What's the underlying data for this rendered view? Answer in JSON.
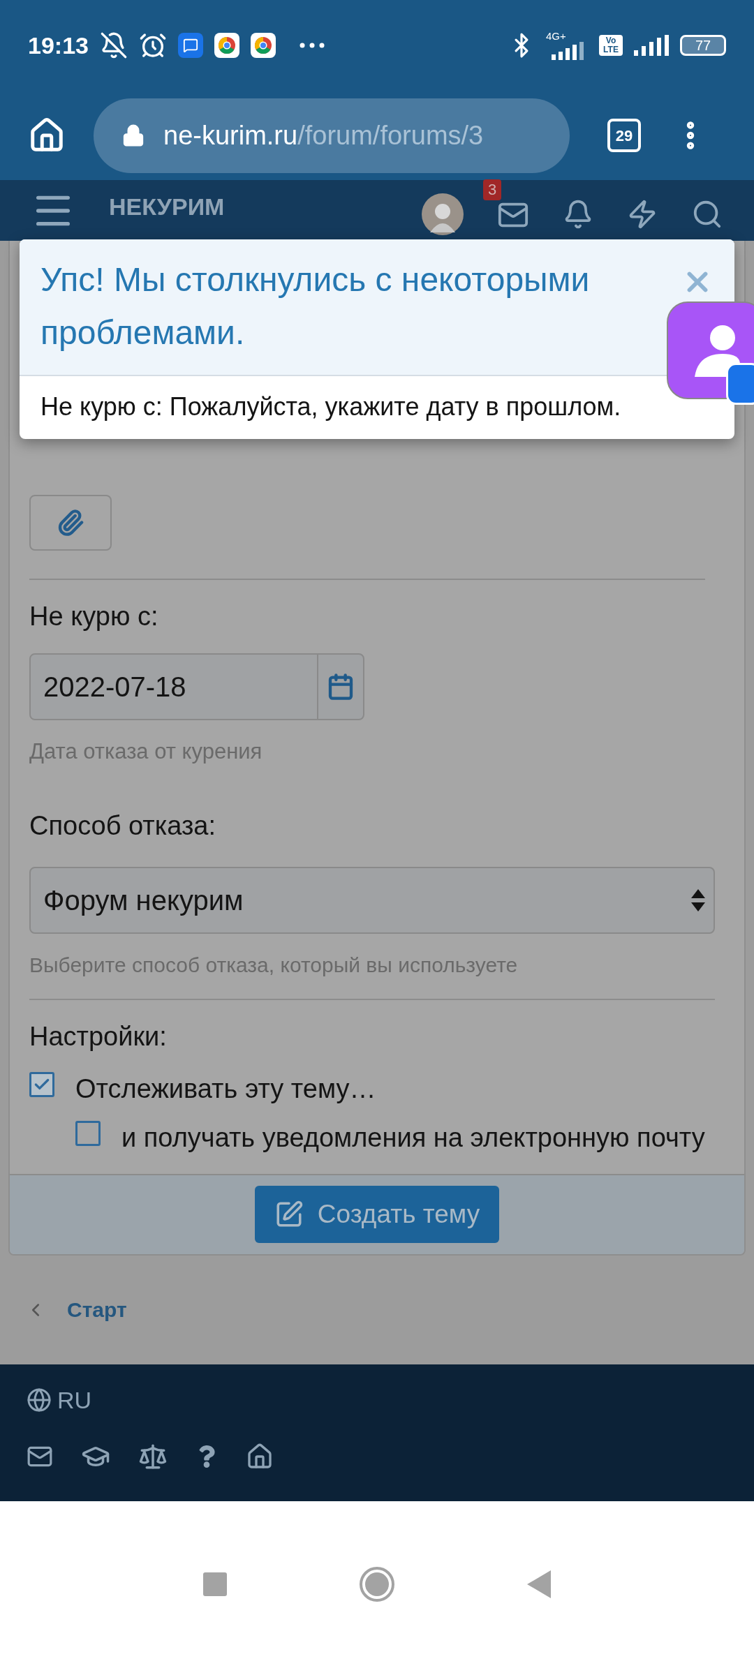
{
  "status_bar": {
    "time": "19:13",
    "network": "4G+",
    "volte": "Vo LTE",
    "battery": "77"
  },
  "browser": {
    "url_domain": "ne-kurim.ru",
    "url_path": "/forum/forums/3",
    "tab_count": "29"
  },
  "site_header": {
    "logo": "НЕКУРИМ",
    "message_badge": "3"
  },
  "error_dialog": {
    "title": "Упс! Мы столкнулись с некоторыми проблемами.",
    "message": "Не курю с: Пожалуйста, укажите дату в прошлом."
  },
  "form": {
    "date_field": {
      "label": "Не курю с:",
      "value": "2022-07-18",
      "hint": "Дата отказа от курения"
    },
    "method_field": {
      "label": "Способ отказа:",
      "value": "Форум некурим",
      "hint": "Выберите способ отказа, который вы используете"
    },
    "settings_label": "Настройки:",
    "options": [
      {
        "label": "Отслеживать эту тему…",
        "checked": true,
        "children": [
          {
            "label": "и получать уведомления на электронную почту",
            "checked": false
          }
        ]
      }
    ],
    "submit_button": "Создать тему"
  },
  "breadcrumb": {
    "label": "Старт"
  },
  "footer": {
    "language": "RU"
  }
}
